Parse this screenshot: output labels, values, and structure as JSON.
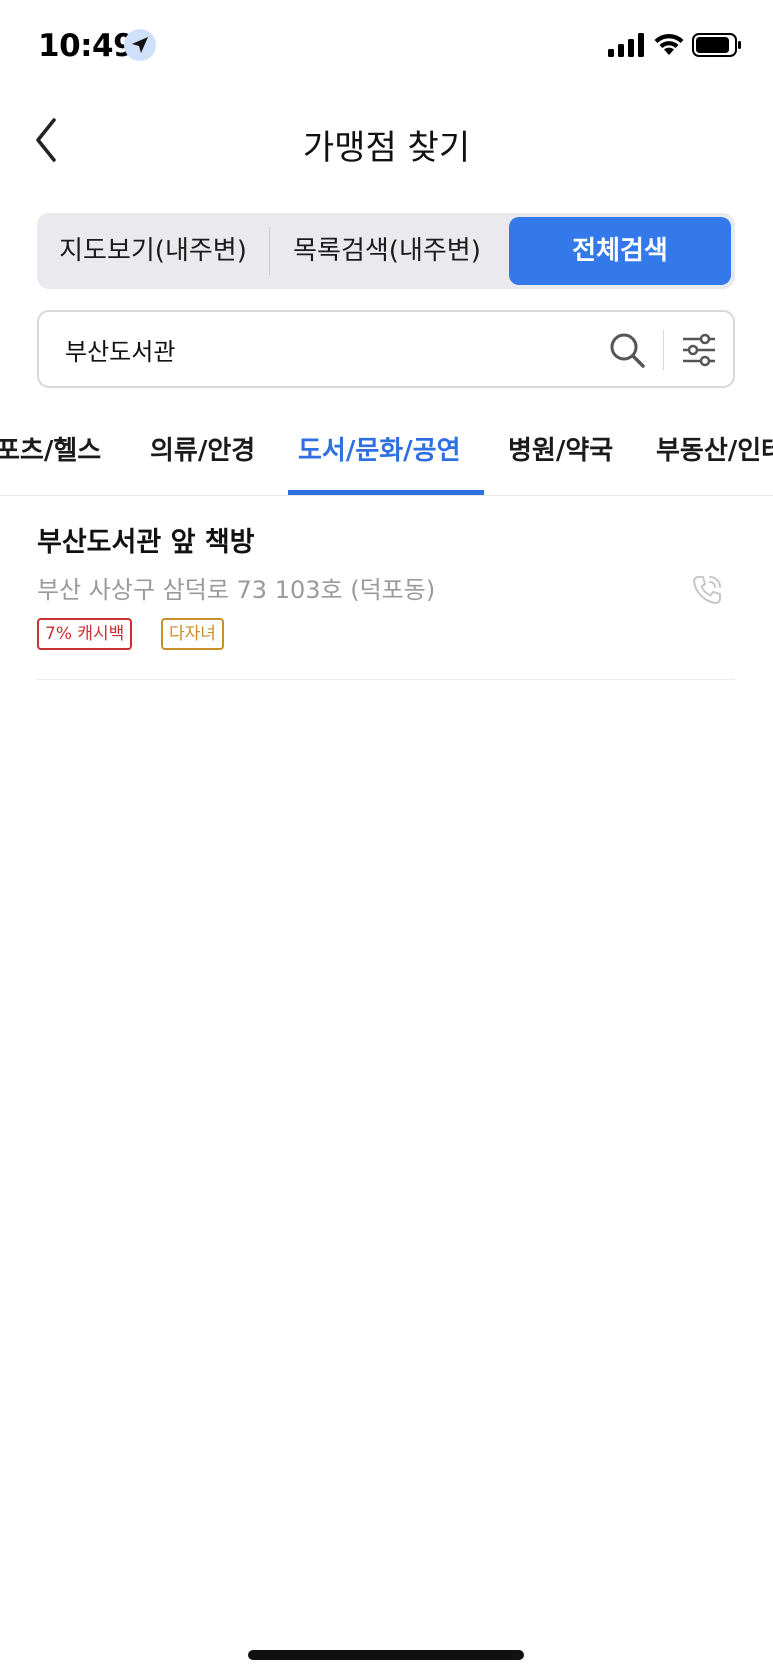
{
  "status_bar": {
    "time": "10:49"
  },
  "header": {
    "title": "가맹점 찾기",
    "back_icon": "chevron-left-icon"
  },
  "segmented": {
    "items": [
      {
        "label": "지도보기(내주변)",
        "selected": false
      },
      {
        "label": "목록검색(내주변)",
        "selected": false
      },
      {
        "label": "전체검색",
        "selected": true
      }
    ],
    "accent_color": "#3479ea"
  },
  "search": {
    "value": "부산도서관",
    "placeholder": ""
  },
  "categories": {
    "items": [
      {
        "label": "포츠/헬스",
        "active": false
      },
      {
        "label": "의류/안경",
        "active": false
      },
      {
        "label": "도서/문화/공연",
        "active": true
      },
      {
        "label": "병원/약국",
        "active": false
      },
      {
        "label": "부동산/인테",
        "active": false
      }
    ],
    "active_color": "#2f6fe0"
  },
  "results": [
    {
      "name": "부산도서관 앞 책방",
      "address": "부산 사상구 삼덕로 73 103호 (덕포동)",
      "badges": [
        {
          "label": "7% 캐시백",
          "color": "#c83232"
        },
        {
          "label": "다자녀",
          "color": "#c98f28"
        }
      ]
    }
  ]
}
